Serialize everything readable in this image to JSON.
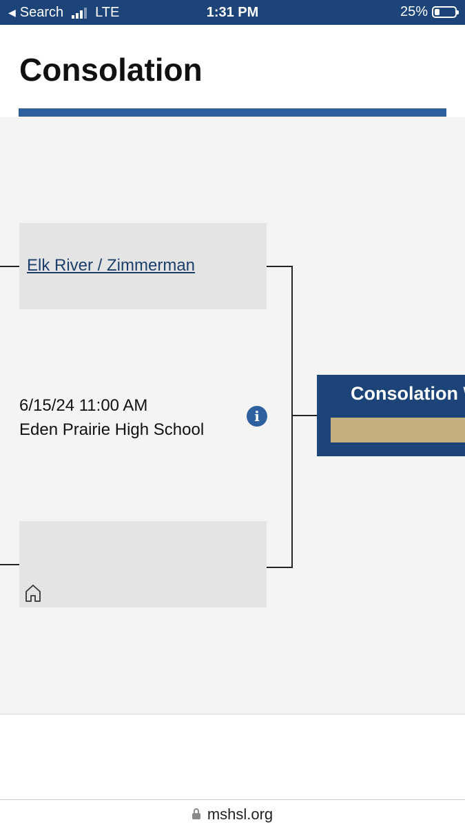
{
  "status_bar": {
    "back_label": "Search",
    "network": "LTE",
    "time": "1:31 PM",
    "battery": "25%",
    "battery_level": 0.25
  },
  "page": {
    "title": "Consolation"
  },
  "bracket": {
    "top_team": "Elk River / Zimmerman",
    "bottom_team": "",
    "game": {
      "datetime": "6/15/24 11:00 AM",
      "location": "Eden Prairie High School"
    },
    "winner_label": "Consolation W",
    "icons": {
      "info": "info-icon",
      "home": "home-icon"
    }
  },
  "browser": {
    "url": "mshsl.org",
    "lock_icon": "lock-icon"
  }
}
